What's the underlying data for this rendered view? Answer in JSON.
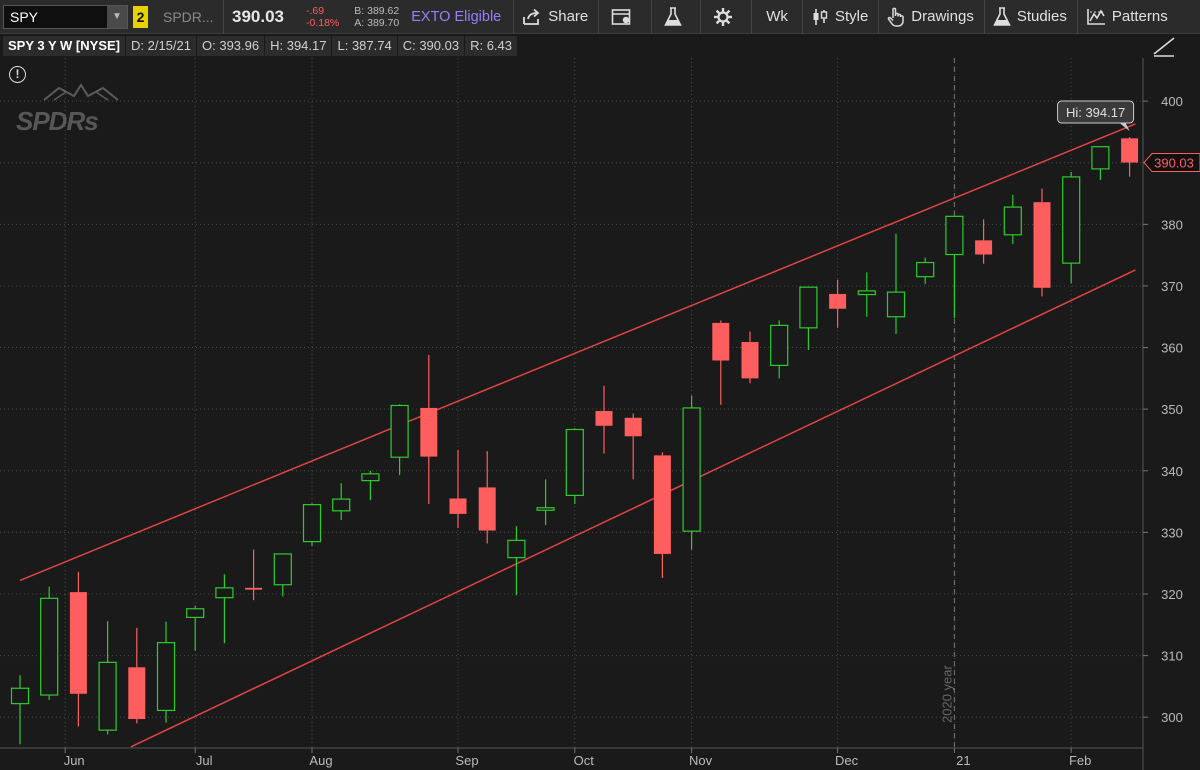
{
  "toolbar": {
    "symbol": "SPY",
    "link_number": "2",
    "description": "SPDR...",
    "last_price": "390.03",
    "net_change": "-.69",
    "pct_change": "-0.18%",
    "bid": "B: 389.62",
    "ask": "A: 389.70",
    "exto_label": "EXTO Eligible",
    "share_label": "Share",
    "timeframe_label": "Wk",
    "style_label": "Style",
    "drawings_label": "Drawings",
    "studies_label": "Studies",
    "patterns_label": "Patterns",
    "colors": {
      "negative": "#ff5c5c",
      "exto": "#9a7dff",
      "link": "#e7d200"
    }
  },
  "infobar": {
    "title": "SPY 3 Y W [NYSE]",
    "date": "D: 2/15/21",
    "open": "O: 393.96",
    "high": "H: 394.17",
    "low": "L: 387.74",
    "close": "C: 390.03",
    "range": "R: 6.43"
  },
  "watermark": "SPDRs",
  "chart_data": {
    "type": "candlestick",
    "title": "",
    "xlabel": "",
    "ylabel": "",
    "ylim": [
      295,
      407
    ],
    "y_ticks": [
      300,
      310,
      320,
      330,
      340,
      350,
      360,
      370,
      380,
      390,
      400
    ],
    "grid": true,
    "x_ticks": [
      {
        "label": "Jun",
        "index": 1
      },
      {
        "label": "Jul",
        "index": 6
      },
      {
        "label": "Aug",
        "index": 10
      },
      {
        "label": "Sep",
        "index": 15
      },
      {
        "label": "Oct",
        "index": 19
      },
      {
        "label": "Nov",
        "index": 23
      },
      {
        "label": "Dec",
        "index": 28
      },
      {
        "label": "21",
        "index": 32
      },
      {
        "label": "Feb",
        "index": 36
      }
    ],
    "year_divider": {
      "label": "2020 year",
      "index": 32
    },
    "candles": [
      {
        "o": 302.2,
        "h": 306.8,
        "l": 295.6,
        "c": 304.7
      },
      {
        "o": 303.6,
        "h": 321.2,
        "l": 302.8,
        "c": 319.3
      },
      {
        "o": 320.3,
        "h": 323.6,
        "l": 298.5,
        "c": 303.8
      },
      {
        "o": 297.9,
        "h": 315.6,
        "l": 297.2,
        "c": 308.9
      },
      {
        "o": 308.1,
        "h": 314.5,
        "l": 299.0,
        "c": 299.7
      },
      {
        "o": 301.1,
        "h": 315.5,
        "l": 299.1,
        "c": 312.1
      },
      {
        "o": 316.2,
        "h": 318.1,
        "l": 310.8,
        "c": 317.6
      },
      {
        "o": 319.4,
        "h": 323.2,
        "l": 312.0,
        "c": 321.0
      },
      {
        "o": 321.0,
        "h": 327.2,
        "l": 319.0,
        "c": 320.7
      },
      {
        "o": 321.5,
        "h": 326.6,
        "l": 319.6,
        "c": 326.5
      },
      {
        "o": 328.5,
        "h": 334.7,
        "l": 327.8,
        "c": 334.5
      },
      {
        "o": 333.5,
        "h": 338.0,
        "l": 332.0,
        "c": 335.4
      },
      {
        "o": 338.4,
        "h": 340.0,
        "l": 335.2,
        "c": 339.5
      },
      {
        "o": 342.2,
        "h": 350.8,
        "l": 339.3,
        "c": 350.6
      },
      {
        "o": 350.2,
        "h": 358.8,
        "l": 334.6,
        "c": 342.3
      },
      {
        "o": 335.5,
        "h": 343.4,
        "l": 330.7,
        "c": 333.0
      },
      {
        "o": 337.3,
        "h": 343.2,
        "l": 328.2,
        "c": 330.3
      },
      {
        "o": 325.9,
        "h": 331.0,
        "l": 319.8,
        "c": 328.7
      },
      {
        "o": 333.6,
        "h": 338.6,
        "l": 331.2,
        "c": 334.0
      },
      {
        "o": 336.0,
        "h": 346.9,
        "l": 334.6,
        "c": 346.7
      },
      {
        "o": 349.7,
        "h": 353.8,
        "l": 342.8,
        "c": 347.3
      },
      {
        "o": 348.6,
        "h": 349.3,
        "l": 338.6,
        "c": 345.6
      },
      {
        "o": 342.5,
        "h": 343.0,
        "l": 322.6,
        "c": 326.5
      },
      {
        "o": 330.2,
        "h": 352.2,
        "l": 327.2,
        "c": 350.2
      },
      {
        "o": 364.0,
        "h": 364.4,
        "l": 350.7,
        "c": 357.9
      },
      {
        "o": 360.9,
        "h": 362.6,
        "l": 354.2,
        "c": 355.0
      },
      {
        "o": 357.1,
        "h": 364.4,
        "l": 355.0,
        "c": 363.6
      },
      {
        "o": 363.2,
        "h": 369.9,
        "l": 359.6,
        "c": 369.8
      },
      {
        "o": 368.7,
        "h": 371.0,
        "l": 363.2,
        "c": 366.3
      },
      {
        "o": 368.6,
        "h": 372.2,
        "l": 365.0,
        "c": 369.2
      },
      {
        "o": 365.0,
        "h": 378.5,
        "l": 362.2,
        "c": 369.0
      },
      {
        "o": 371.5,
        "h": 374.6,
        "l": 370.3,
        "c": 373.8
      },
      {
        "o": 375.1,
        "h": 381.3,
        "l": 364.8,
        "c": 381.3
      },
      {
        "o": 377.4,
        "h": 380.8,
        "l": 373.6,
        "c": 375.1
      },
      {
        "o": 378.3,
        "h": 384.8,
        "l": 376.8,
        "c": 382.8
      },
      {
        "o": 383.6,
        "h": 385.8,
        "l": 368.3,
        "c": 369.7
      },
      {
        "o": 373.7,
        "h": 388.5,
        "l": 370.4,
        "c": 387.7
      },
      {
        "o": 389.0,
        "h": 392.5,
        "l": 387.2,
        "c": 392.6
      },
      {
        "o": 393.96,
        "h": 394.17,
        "l": 387.74,
        "c": 390.03
      }
    ],
    "trendlines": [
      {
        "name": "upper-channel",
        "start": {
          "index": 0,
          "value": 322.2
        },
        "end": {
          "index": 38.2,
          "value": 396.3
        }
      },
      {
        "name": "lower-channel",
        "start": {
          "index": 3.8,
          "value": 295.2
        },
        "end": {
          "index": 38.2,
          "value": 372.6
        }
      }
    ],
    "high_label": "Hi: 394.17",
    "last_label": "390.03",
    "colors": {
      "up": "#2dcc2d",
      "down": "#ff5e5e",
      "trend": "#e04444",
      "background": "#1a1a1a",
      "grid": "#4a4a4a"
    }
  }
}
